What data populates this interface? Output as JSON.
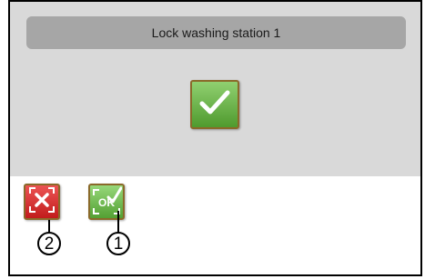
{
  "dialog": {
    "title": "Lock washing station 1"
  },
  "buttons": {
    "confirm_icon": "checkmark-icon",
    "cancel_icon": "cancel-x-icon",
    "ok_icon": "ok-check-icon",
    "ok_text": "OK"
  },
  "callouts": {
    "cancel": "2",
    "ok": "1"
  },
  "colors": {
    "panel": "#d9d9d9",
    "title_bar": "#a6a6a6",
    "green": "#5aa83a",
    "red": "#d32f2f"
  }
}
